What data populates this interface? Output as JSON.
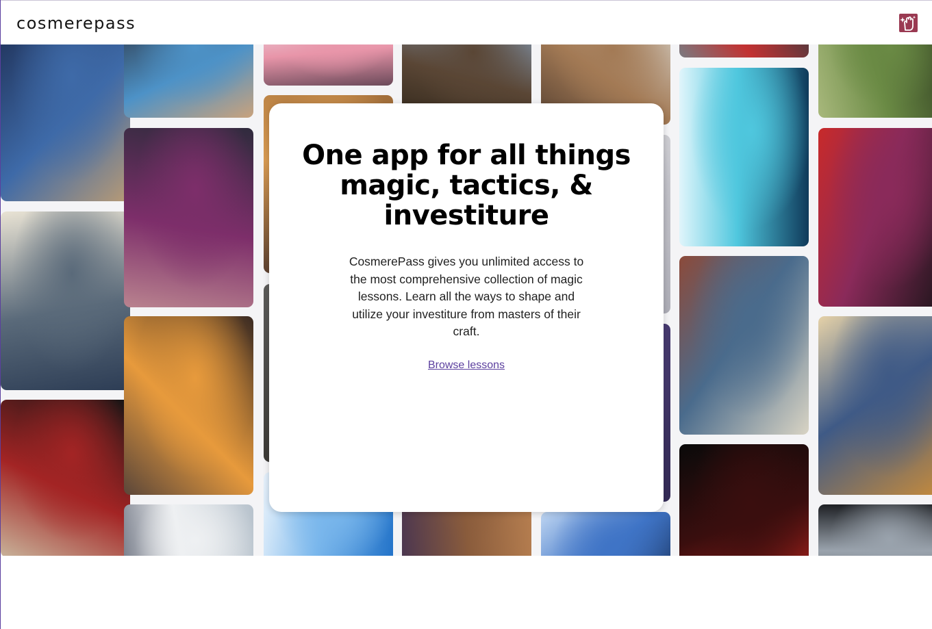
{
  "header": {
    "brand": "cosmerepass",
    "account_icon": "hand-sparkle-icon",
    "account_color": "#9a3a52"
  },
  "gallery": {
    "columns": [
      {
        "cards": [
          {
            "name": "card-windrunner-flight",
            "colors": [
              "#1d2d52",
              "#3e6aa8",
              "#b99b75"
            ]
          },
          {
            "name": "card-kaladin-spear",
            "colors": [
              "#e9e3d4",
              "#5a6a7a",
              "#2d3d55"
            ]
          },
          {
            "name": "card-shardplate-knight",
            "colors": [
              "#151515",
              "#a32424",
              "#c8b39a"
            ]
          }
        ]
      },
      {
        "cards": [
          {
            "name": "card-lightning-duel",
            "colors": [
              "#2c3342",
              "#4d92c7",
              "#c9a27c"
            ]
          },
          {
            "name": "card-jasnah-shadow",
            "colors": [
              "#2f2b3d",
              "#7d2e6a",
              "#b9838f"
            ]
          },
          {
            "name": "card-burning-citadel",
            "colors": [
              "#3a2a22",
              "#e79a3c",
              "#5a463a"
            ]
          },
          {
            "name": "card-sunlit-dome",
            "colors": [
              "#b7c2cc",
              "#eef0f2",
              "#6c7280"
            ]
          }
        ]
      },
      {
        "cards": [
          {
            "name": "card-ribbon-spell",
            "colors": [
              "#e9e4ea",
              "#e895a9",
              "#6b4a5a"
            ]
          },
          {
            "name": "card-amber-sky",
            "colors": [
              "#a06d3a",
              "#d89a52",
              "#5b4030"
            ]
          },
          {
            "name": "card-dark-arena",
            "colors": [
              "#2a2a2c",
              "#60605f",
              "#3c3a36"
            ]
          },
          {
            "name": "card-blue-heavens",
            "colors": [
              "#1f70c7",
              "#7ab7ec",
              "#e8f2fb"
            ]
          }
        ]
      },
      {
        "cards": [
          {
            "name": "card-armored-giant",
            "colors": [
              "#8aa8c8",
              "#5a4635",
              "#2d2418"
            ]
          },
          {
            "name": "card-hidden-middle",
            "colors": [
              "#6a6a6a",
              "#9a9a9a",
              "#4a4a4a"
            ]
          },
          {
            "name": "card-dusk-warrior",
            "colors": [
              "#c08654",
              "#8a5c3c",
              "#4b3650"
            ]
          }
        ]
      },
      {
        "cards": [
          {
            "name": "card-bronze-sentinel",
            "colors": [
              "#d6d2ca",
              "#a37a55",
              "#584232"
            ]
          },
          {
            "name": "card-grey-mist",
            "colors": [
              "#cfcfd4",
              "#9a9aa6",
              "#77778a"
            ]
          },
          {
            "name": "card-violet-night",
            "colors": [
              "#332a55",
              "#5a4a8a",
              "#222233"
            ]
          },
          {
            "name": "card-frost-blade",
            "colors": [
              "#0e1e3c",
              "#3f74c6",
              "#bfd6f2"
            ]
          }
        ]
      },
      {
        "cards": [
          {
            "name": "card-red-veins",
            "colors": [
              "#3a3a40",
              "#c23232",
              "#7a7a80"
            ]
          },
          {
            "name": "card-storm-caller",
            "colors": [
              "#0f3a5a",
              "#4fc7de",
              "#e0f5fb"
            ]
          },
          {
            "name": "card-stained-glass-mage",
            "colors": [
              "#d9d4c4",
              "#4a6b8c",
              "#8c4a3a"
            ]
          },
          {
            "name": "card-crimson-void",
            "colors": [
              "#d92a22",
              "#3a0e0e",
              "#0a0a0a"
            ]
          }
        ]
      },
      {
        "cards": [
          {
            "name": "card-forest-spirit",
            "colors": [
              "#2e3b20",
              "#6a8a44",
              "#a8b87c"
            ]
          },
          {
            "name": "card-lightweaver-storm",
            "colors": [
              "#1a1418",
              "#8a2a5a",
              "#c82a2a"
            ]
          },
          {
            "name": "card-golden-swirl",
            "colors": [
              "#c98c3a",
              "#3f5a86",
              "#e6d2a8"
            ]
          },
          {
            "name": "card-ashen-duel",
            "colors": [
              "#3a3d44",
              "#9aa3ad",
              "#1e2024"
            ]
          }
        ]
      }
    ]
  },
  "modal": {
    "title": "One app for all things magic, tactics, & investiture",
    "description": "CosmerePass gives you unlimited access to the most comprehensive collection of magic lessons. Learn all the ways to shape and utilize your investiture from masters of their craft.",
    "cta": "Browse lessons",
    "link_color": "#5b3f9e"
  }
}
